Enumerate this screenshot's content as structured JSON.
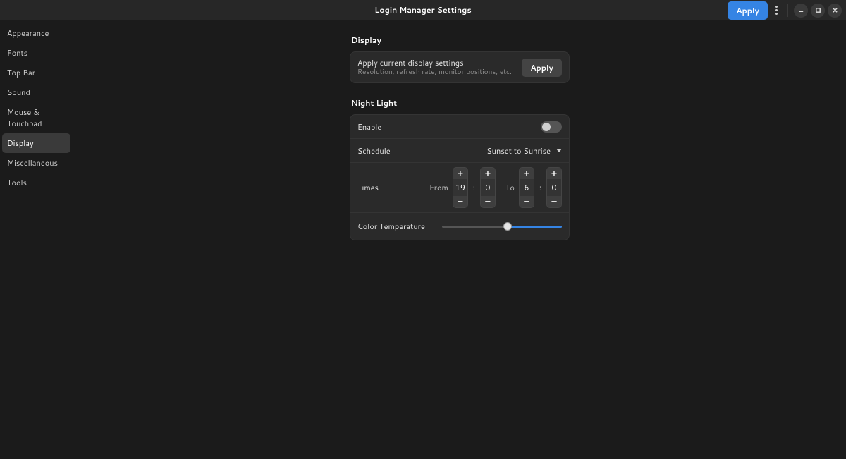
{
  "header": {
    "title": "Login Manager Settings",
    "apply_label": "Apply"
  },
  "sidebar": {
    "items": [
      {
        "label": "Appearance"
      },
      {
        "label": "Fonts"
      },
      {
        "label": "Top Bar"
      },
      {
        "label": "Sound"
      },
      {
        "label": "Mouse & Touchpad"
      },
      {
        "label": "Display"
      },
      {
        "label": "Miscellaneous"
      },
      {
        "label": "Tools"
      }
    ],
    "active_index": 5
  },
  "display": {
    "section_title": "Display",
    "apply_row": {
      "title": "Apply current display settings",
      "subtitle": "Resolution, refresh rate, monitor positions, etc.",
      "button": "Apply"
    }
  },
  "night_light": {
    "section_title": "Night Light",
    "enable": {
      "label": "Enable",
      "on": false
    },
    "schedule": {
      "label": "Schedule",
      "value": "Sunset to Sunrise"
    },
    "times": {
      "label": "Times",
      "from_label": "From",
      "to_label": "To",
      "from_h": "19",
      "from_m": "0",
      "to_h": "6",
      "to_m": "0"
    },
    "color_temp": {
      "label": "Color Temperature",
      "percent": 55
    }
  },
  "icons": {
    "plus": "+",
    "minus": "–"
  }
}
